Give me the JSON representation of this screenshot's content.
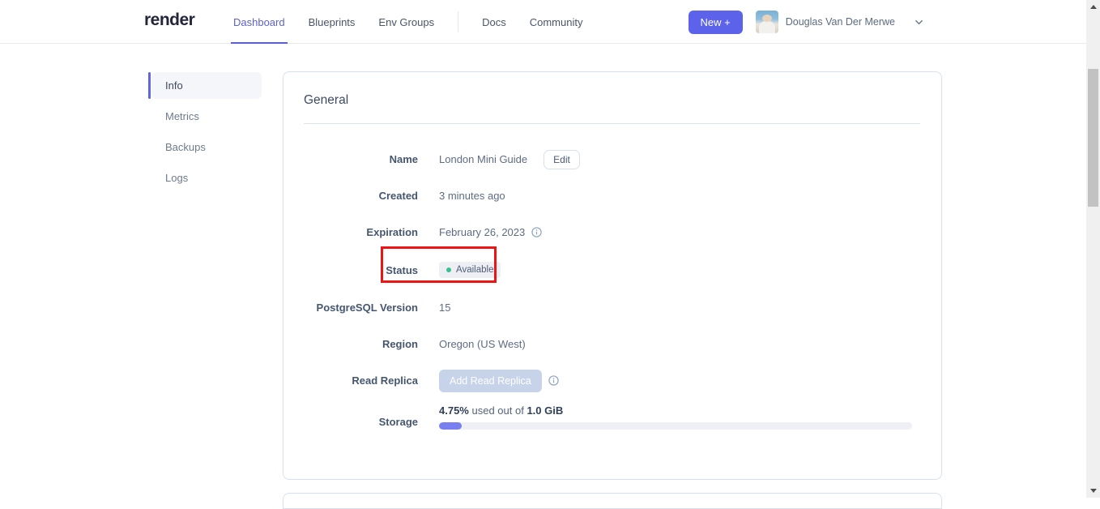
{
  "header": {
    "logo": "render",
    "nav": [
      {
        "label": "Dashboard",
        "active": true
      },
      {
        "label": "Blueprints",
        "active": false
      },
      {
        "label": "Env Groups",
        "active": false
      },
      {
        "label": "Docs",
        "active": false
      },
      {
        "label": "Community",
        "active": false
      }
    ],
    "new_button_label": "New +",
    "user_name": "Douglas Van Der Merwe"
  },
  "sidebar": {
    "items": [
      {
        "label": "Info",
        "active": true
      },
      {
        "label": "Metrics",
        "active": false
      },
      {
        "label": "Backups",
        "active": false
      },
      {
        "label": "Logs",
        "active": false
      }
    ]
  },
  "general": {
    "title": "General",
    "name": {
      "label": "Name",
      "value": "London Mini Guide",
      "edit_button": "Edit"
    },
    "created": {
      "label": "Created",
      "value": "3 minutes ago"
    },
    "expiration": {
      "label": "Expiration",
      "value": "February 26, 2023"
    },
    "status": {
      "label": "Status",
      "value": "Available"
    },
    "version": {
      "label": "PostgreSQL Version",
      "value": "15"
    },
    "region": {
      "label": "Region",
      "value": "Oregon (US West)"
    },
    "read_replica": {
      "label": "Read Replica",
      "button": "Add Read Replica"
    },
    "storage": {
      "label": "Storage",
      "used_pct": "4.75%",
      "middle_text": "used out of",
      "total": "1.0 GiB",
      "progress_pct": 4.75
    }
  },
  "colors": {
    "accent": "#5c63ea",
    "active_nav": "#5a61d2",
    "status_dot_green": "#3ac08f",
    "annotation_red": "#ee1414",
    "progress_fill": "#7a7ff0"
  }
}
